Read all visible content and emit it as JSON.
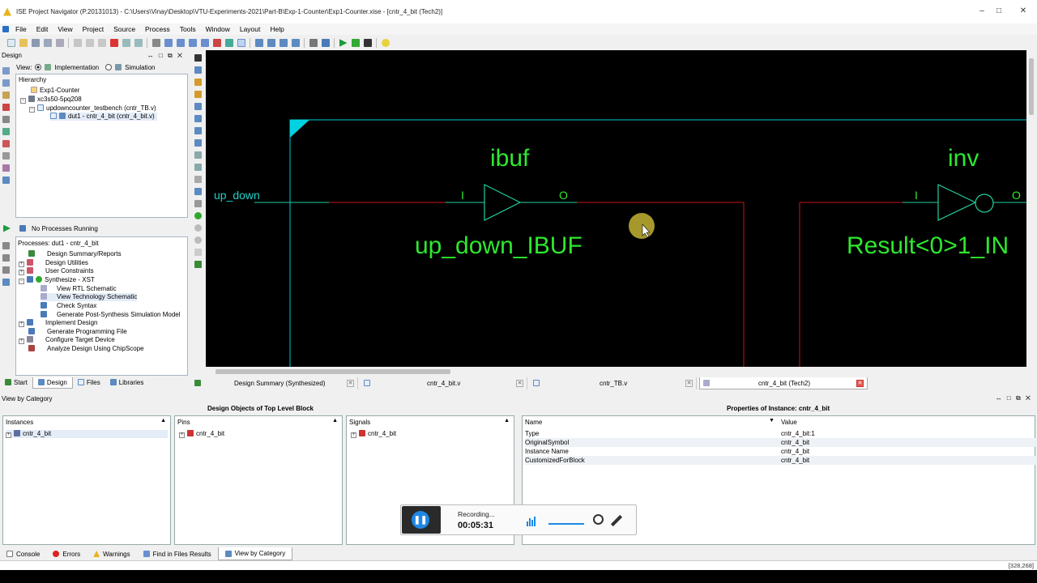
{
  "window": {
    "title": "ISE Project Navigator (P.20131013) - C:\\Users\\Vinay\\Desktop\\VTU-Experiments-2021\\Part-B\\Exp-1-Counter\\Exp1-Counter.xise - [cntr_4_bit (Tech2)]",
    "minimize": "–",
    "maximize": "□",
    "close": "✕"
  },
  "menu": [
    "File",
    "Edit",
    "View",
    "Project",
    "Source",
    "Process",
    "Tools",
    "Window",
    "Layout",
    "Help"
  ],
  "design_panel": {
    "title": "Design",
    "view_label": "View:",
    "view_impl": "Implementation",
    "view_sim": "Simulation",
    "hierarchy_label": "Hierarchy",
    "tree": [
      "Exp1-Counter",
      "xc3s50-5pq208",
      "updowncounter_testbench (cntr_TB.v)",
      "dut1 - cntr_4_bit (cntr_4_bit.v)"
    ]
  },
  "process_panel": {
    "status": "No Processes Running",
    "header": "Processes: dut1 - cntr_4_bit",
    "items": [
      "Design Summary/Reports",
      "Design Utilities",
      "User Constraints",
      "Synthesize - XST",
      "View RTL Schematic",
      "View Technology Schematic",
      "Check Syntax",
      "Generate Post-Synthesis Simulation Model",
      "Implement Design",
      "Generate Programming File",
      "Configure Target Device",
      "Analyze Design Using ChipScope"
    ]
  },
  "schematic": {
    "port": "up_down",
    "ibuf_label": "ibuf",
    "ibuf_pin_in": "I",
    "ibuf_pin_out": "O",
    "ibuf_name": "up_down_IBUF",
    "inv_label": "inv",
    "inv_pin_in": "I",
    "inv_pin_out": "O",
    "inv_name": "Result<0>1_IN",
    "colors": {
      "text": "#2ee82e",
      "wire": "#c8141e",
      "net": "#1fd0a0",
      "border": "#00c8d0"
    }
  },
  "left_tabs": [
    "Start",
    "Design",
    "Files",
    "Libraries"
  ],
  "doc_tabs": [
    "Design Summary (Synthesized)",
    "cntr_4_bit.v",
    "cntr_TB.v",
    "cntr_4_bit (Tech2)"
  ],
  "bottom": {
    "view_by_category": "View by Category",
    "objects_title": "Design Objects of Top Level Block",
    "props_title": "Properties of Instance: cntr_4_bit",
    "instances_hdr": "Instances",
    "pins_hdr": "Pins",
    "signals_hdr": "Signals",
    "item": "cntr_4_bit",
    "name_hdr": "Name",
    "value_hdr": "Value",
    "props": [
      {
        "name": "Type",
        "value": "cntr_4_bit:1"
      },
      {
        "name": "OriginalSymbol",
        "value": "cntr_4_bit"
      },
      {
        "name": "Instance Name",
        "value": "cntr_4_bit"
      },
      {
        "name": "CustomizedForBlock",
        "value": "cntr_4_bit"
      }
    ]
  },
  "status_tabs": [
    "Console",
    "Errors",
    "Warnings",
    "Find in Files Results",
    "View by Category"
  ],
  "coords": "[328,268]",
  "recorder": {
    "label": "Recording...",
    "time": "00:05:31"
  }
}
